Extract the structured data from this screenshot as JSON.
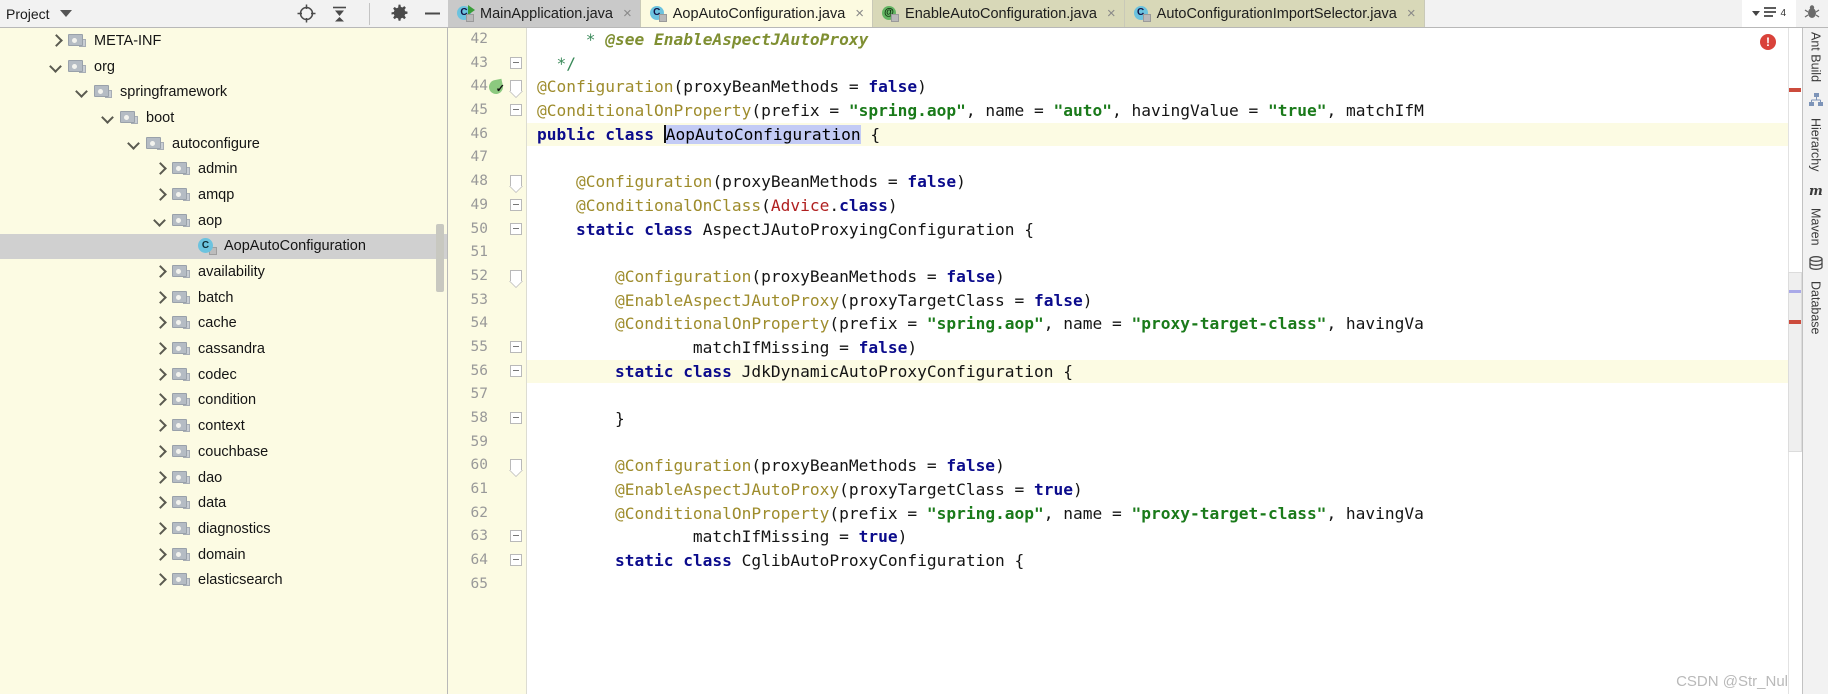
{
  "window": {
    "project_panel_title": "Project",
    "watermark": "CSDN @Str_Nul"
  },
  "project_toolbar": {
    "icons": [
      "locate-target-icon",
      "collapse-all-icon",
      "settings-gear-icon",
      "hide-panel-icon"
    ]
  },
  "tabs": {
    "overflow_label": "4",
    "items": [
      {
        "label": "MainApplication.java",
        "icon": "java-class-run-icon",
        "state": "inactive",
        "close": "×"
      },
      {
        "label": "AopAutoConfiguration.java",
        "icon": "java-class-icon",
        "state": "active",
        "close": "×"
      },
      {
        "label": "EnableAutoConfiguration.java",
        "icon": "java-annotation-icon",
        "state": "olive",
        "close": "×"
      },
      {
        "label": "AutoConfigurationImportSelector.java",
        "icon": "java-class-icon",
        "state": "olive",
        "close": "×"
      }
    ]
  },
  "tree": {
    "nodes": [
      {
        "label": "META-INF",
        "depth": 1,
        "twisty": "right",
        "icon": "folder-icon",
        "selected": false
      },
      {
        "label": "org",
        "depth": 1,
        "twisty": "down",
        "icon": "folder-icon",
        "selected": false
      },
      {
        "label": "springframework",
        "depth": 2,
        "twisty": "down",
        "icon": "folder-icon",
        "selected": false
      },
      {
        "label": "boot",
        "depth": 3,
        "twisty": "down",
        "icon": "folder-icon",
        "selected": false
      },
      {
        "label": "autoconfigure",
        "depth": 4,
        "twisty": "down",
        "icon": "folder-icon",
        "selected": false
      },
      {
        "label": "admin",
        "depth": 5,
        "twisty": "right",
        "icon": "folder-icon",
        "selected": false
      },
      {
        "label": "amqp",
        "depth": 5,
        "twisty": "right",
        "icon": "folder-icon",
        "selected": false
      },
      {
        "label": "aop",
        "depth": 5,
        "twisty": "down",
        "icon": "folder-icon",
        "selected": false
      },
      {
        "label": "AopAutoConfiguration",
        "depth": 6,
        "twisty": "none",
        "icon": "java-class-icon",
        "selected": true
      },
      {
        "label": "availability",
        "depth": 5,
        "twisty": "right",
        "icon": "folder-icon",
        "selected": false
      },
      {
        "label": "batch",
        "depth": 5,
        "twisty": "right",
        "icon": "folder-icon",
        "selected": false
      },
      {
        "label": "cache",
        "depth": 5,
        "twisty": "right",
        "icon": "folder-icon",
        "selected": false
      },
      {
        "label": "cassandra",
        "depth": 5,
        "twisty": "right",
        "icon": "folder-icon",
        "selected": false
      },
      {
        "label": "codec",
        "depth": 5,
        "twisty": "right",
        "icon": "folder-icon",
        "selected": false
      },
      {
        "label": "condition",
        "depth": 5,
        "twisty": "right",
        "icon": "folder-icon",
        "selected": false
      },
      {
        "label": "context",
        "depth": 5,
        "twisty": "right",
        "icon": "folder-icon",
        "selected": false
      },
      {
        "label": "couchbase",
        "depth": 5,
        "twisty": "right",
        "icon": "folder-icon",
        "selected": false
      },
      {
        "label": "dao",
        "depth": 5,
        "twisty": "right",
        "icon": "folder-icon",
        "selected": false
      },
      {
        "label": "data",
        "depth": 5,
        "twisty": "right",
        "icon": "folder-icon",
        "selected": false
      },
      {
        "label": "diagnostics",
        "depth": 5,
        "twisty": "right",
        "icon": "folder-icon",
        "selected": false
      },
      {
        "label": "domain",
        "depth": 5,
        "twisty": "right",
        "icon": "folder-icon",
        "selected": false
      },
      {
        "label": "elasticsearch",
        "depth": 5,
        "twisty": "right",
        "icon": "folder-icon",
        "selected": false
      }
    ]
  },
  "editor": {
    "first_line": 42,
    "lines": [
      {
        "n": 42,
        "highlight": false,
        "gutter": "none",
        "fold": "none",
        "segments": [
          {
            "t": "     * ",
            "c": "cm"
          },
          {
            "t": "@see ",
            "c": "cmi"
          },
          {
            "t": "EnableAspectJAutoProxy",
            "c": "cmi"
          }
        ]
      },
      {
        "n": 43,
        "highlight": false,
        "gutter": "none",
        "fold": "dash-end",
        "segments": [
          {
            "t": "  */",
            "c": "cm"
          }
        ]
      },
      {
        "n": 44,
        "highlight": false,
        "gutter": "run-config",
        "fold": "tri",
        "segments": [
          {
            "t": "@Configuration",
            "c": "an"
          },
          {
            "t": "(proxyBeanMethods = ",
            "c": "pl"
          },
          {
            "t": "false",
            "c": "k"
          },
          {
            "t": ")",
            "c": "pl"
          }
        ]
      },
      {
        "n": 45,
        "highlight": false,
        "gutter": "none",
        "fold": "dash",
        "segments": [
          {
            "t": "@ConditionalOnProperty",
            "c": "an"
          },
          {
            "t": "(prefix = ",
            "c": "pl"
          },
          {
            "t": "\"spring.aop\"",
            "c": "st"
          },
          {
            "t": ", name = ",
            "c": "pl"
          },
          {
            "t": "\"auto\"",
            "c": "st"
          },
          {
            "t": ", havingValue = ",
            "c": "pl"
          },
          {
            "t": "\"true\"",
            "c": "st"
          },
          {
            "t": ", matchIfM",
            "c": "pl"
          }
        ]
      },
      {
        "n": 46,
        "highlight": true,
        "gutter": "none",
        "fold": "none",
        "segments": [
          {
            "t": "public class ",
            "c": "k"
          },
          {
            "t": "AopAutoConfiguration",
            "c": "sel"
          },
          {
            "t": " {",
            "c": "pl"
          }
        ]
      },
      {
        "n": 47,
        "highlight": false,
        "gutter": "none",
        "fold": "none",
        "segments": []
      },
      {
        "n": 48,
        "highlight": false,
        "gutter": "none",
        "fold": "tri",
        "segments": [
          {
            "t": "    @Configuration",
            "c": "an"
          },
          {
            "t": "(proxyBeanMethods = ",
            "c": "pl"
          },
          {
            "t": "false",
            "c": "k"
          },
          {
            "t": ")",
            "c": "pl"
          }
        ]
      },
      {
        "n": 49,
        "highlight": false,
        "gutter": "none",
        "fold": "dash",
        "segments": [
          {
            "t": "    @ConditionalOnClass",
            "c": "an"
          },
          {
            "t": "(",
            "c": "pl"
          },
          {
            "t": "Advice",
            "c": "ty"
          },
          {
            "t": ".",
            "c": "pl"
          },
          {
            "t": "class",
            "c": "k"
          },
          {
            "t": ")",
            "c": "pl"
          }
        ]
      },
      {
        "n": 50,
        "highlight": false,
        "gutter": "none",
        "fold": "dash",
        "segments": [
          {
            "t": "    ",
            "c": "pl"
          },
          {
            "t": "static class ",
            "c": "k"
          },
          {
            "t": "AspectJAutoProxyingConfiguration {",
            "c": "pl"
          }
        ]
      },
      {
        "n": 51,
        "highlight": false,
        "gutter": "none",
        "fold": "none",
        "segments": []
      },
      {
        "n": 52,
        "highlight": false,
        "gutter": "none",
        "fold": "tri",
        "segments": [
          {
            "t": "        @Configuration",
            "c": "an"
          },
          {
            "t": "(proxyBeanMethods = ",
            "c": "pl"
          },
          {
            "t": "false",
            "c": "k"
          },
          {
            "t": ")",
            "c": "pl"
          }
        ]
      },
      {
        "n": 53,
        "highlight": false,
        "gutter": "none",
        "fold": "none",
        "segments": [
          {
            "t": "        @EnableAspectJAutoProxy",
            "c": "an"
          },
          {
            "t": "(proxyTargetClass = ",
            "c": "pl"
          },
          {
            "t": "false",
            "c": "k"
          },
          {
            "t": ")",
            "c": "pl"
          }
        ]
      },
      {
        "n": 54,
        "highlight": false,
        "gutter": "none",
        "fold": "none",
        "segments": [
          {
            "t": "        @ConditionalOnProperty",
            "c": "an"
          },
          {
            "t": "(prefix = ",
            "c": "pl"
          },
          {
            "t": "\"spring.aop\"",
            "c": "st"
          },
          {
            "t": ", name = ",
            "c": "pl"
          },
          {
            "t": "\"proxy-target-class\"",
            "c": "st"
          },
          {
            "t": ", havingVa",
            "c": "pl"
          }
        ]
      },
      {
        "n": 55,
        "highlight": false,
        "gutter": "none",
        "fold": "dash",
        "segments": [
          {
            "t": "                matchIfMissing = ",
            "c": "pl"
          },
          {
            "t": "false",
            "c": "k"
          },
          {
            "t": ")",
            "c": "pl"
          }
        ]
      },
      {
        "n": 56,
        "highlight": true,
        "gutter": "none",
        "fold": "dash",
        "segments": [
          {
            "t": "        ",
            "c": "pl"
          },
          {
            "t": "static class ",
            "c": "k"
          },
          {
            "t": "JdkDynamicAutoProxyConfiguration {",
            "c": "pl"
          }
        ]
      },
      {
        "n": 57,
        "highlight": false,
        "gutter": "none",
        "fold": "none",
        "segments": []
      },
      {
        "n": 58,
        "highlight": false,
        "gutter": "none",
        "fold": "dash-end",
        "segments": [
          {
            "t": "        }",
            "c": "pl"
          }
        ]
      },
      {
        "n": 59,
        "highlight": false,
        "gutter": "none",
        "fold": "none",
        "segments": []
      },
      {
        "n": 60,
        "highlight": false,
        "gutter": "none",
        "fold": "tri",
        "segments": [
          {
            "t": "        @Configuration",
            "c": "an"
          },
          {
            "t": "(proxyBeanMethods = ",
            "c": "pl"
          },
          {
            "t": "false",
            "c": "k"
          },
          {
            "t": ")",
            "c": "pl"
          }
        ]
      },
      {
        "n": 61,
        "highlight": false,
        "gutter": "none",
        "fold": "none",
        "segments": [
          {
            "t": "        @EnableAspectJAutoProxy",
            "c": "an"
          },
          {
            "t": "(proxyTargetClass = ",
            "c": "pl"
          },
          {
            "t": "true",
            "c": "k"
          },
          {
            "t": ")",
            "c": "pl"
          }
        ]
      },
      {
        "n": 62,
        "highlight": false,
        "gutter": "none",
        "fold": "none",
        "segments": [
          {
            "t": "        @ConditionalOnProperty",
            "c": "an"
          },
          {
            "t": "(prefix = ",
            "c": "pl"
          },
          {
            "t": "\"spring.aop\"",
            "c": "st"
          },
          {
            "t": ", name = ",
            "c": "pl"
          },
          {
            "t": "\"proxy-target-class\"",
            "c": "st"
          },
          {
            "t": ", havingVa",
            "c": "pl"
          }
        ]
      },
      {
        "n": 63,
        "highlight": false,
        "gutter": "none",
        "fold": "dash",
        "segments": [
          {
            "t": "                matchIfMissing = ",
            "c": "pl"
          },
          {
            "t": "true",
            "c": "k"
          },
          {
            "t": ")",
            "c": "pl"
          }
        ]
      },
      {
        "n": 64,
        "highlight": false,
        "gutter": "none",
        "fold": "dash",
        "segments": [
          {
            "t": "        ",
            "c": "pl"
          },
          {
            "t": "static class ",
            "c": "k"
          },
          {
            "t": "CglibAutoProxyConfiguration {",
            "c": "pl"
          }
        ]
      },
      {
        "n": 65,
        "highlight": false,
        "gutter": "none",
        "fold": "none",
        "segments": []
      }
    ],
    "error_badge": "!"
  },
  "right_rail": {
    "items": [
      "Ant Build",
      "Hierarchy",
      "Maven",
      "Database"
    ]
  },
  "colors": {
    "tab_active_bg": "#fcfae0",
    "tab_inactive_bg": "#c9c9c9",
    "tree_bg": "#fcfbe3",
    "selection": "#c3cbf5",
    "keyword": "#0b0b8c",
    "annotation": "#9e8c2c",
    "string": "#1a7a1a",
    "type": "#b02020",
    "error": "#d9423a"
  }
}
